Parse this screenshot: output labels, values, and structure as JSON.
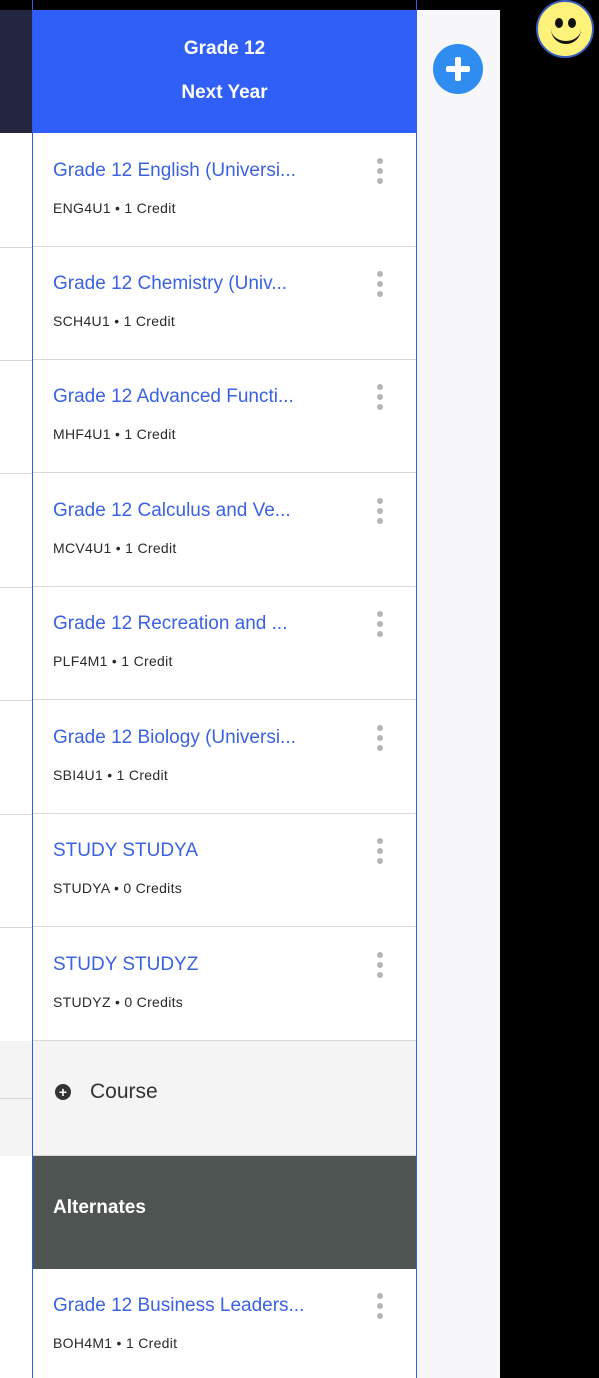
{
  "grade_column": {
    "title": "Grade 12",
    "subtitle": "Next Year",
    "courses": [
      {
        "name": "Grade 12 English (Universi...",
        "meta": "ENG4U1 • 1 Credit"
      },
      {
        "name": "Grade 12 Chemistry (Univ...",
        "meta": "SCH4U1 • 1 Credit"
      },
      {
        "name": "Grade 12 Advanced Functi...",
        "meta": "MHF4U1 • 1 Credit"
      },
      {
        "name": "Grade 12 Calculus and Ve...",
        "meta": "MCV4U1 • 1 Credit"
      },
      {
        "name": "Grade 12 Recreation and ...",
        "meta": "PLF4M1 • 1 Credit"
      },
      {
        "name": "Grade 12 Biology (Universi...",
        "meta": "SBI4U1 • 1 Credit"
      },
      {
        "name": "STUDY STUDYA",
        "meta": "STUDYA • 0 Credits"
      },
      {
        "name": "STUDY STUDYZ",
        "meta": "STUDYZ • 0 Credits"
      }
    ],
    "add_course_label": "Course",
    "alternates_label": "Alternates",
    "alternates": [
      {
        "name": "Grade 12 Business Leaders...",
        "meta": "BOH4M1 • 1 Credit"
      }
    ]
  },
  "icons": {
    "kebab": "more-vertical-icon",
    "add_course": "plus-circle-icon",
    "add_term": "plus-circle-icon",
    "overlay": "smiley-icon"
  },
  "colors": {
    "header_blue": "#2f5ff7",
    "course_link": "#3b62e2",
    "alternates_header": "#4e5452",
    "add_button": "#2f8cf0",
    "left_header": "#242640"
  }
}
